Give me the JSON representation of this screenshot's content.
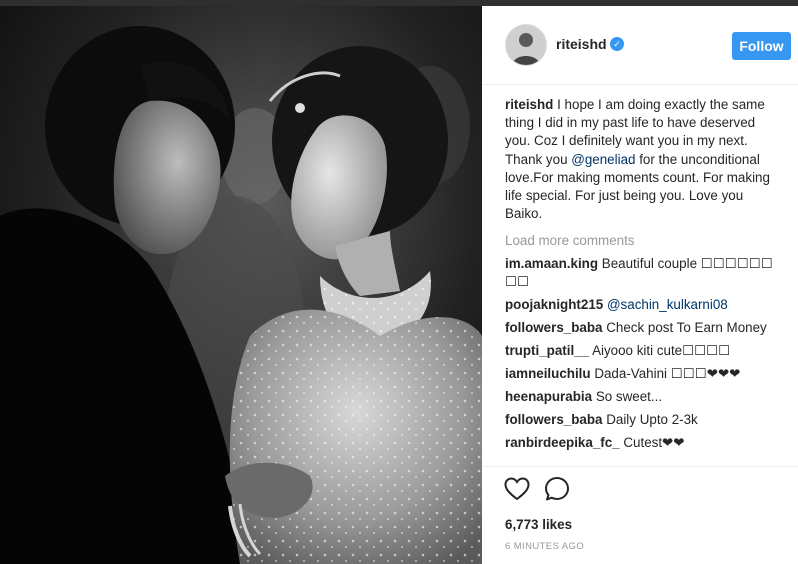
{
  "post": {
    "username": "riteishd",
    "follow_label": "Follow",
    "caption_author": "riteishd",
    "caption_part1": "I hope I am doing exactly the same thing I did in my past life to have deserved you. Coz I definitely want you in my next. Thank you ",
    "caption_mention": "@geneliad",
    "caption_part2": " for the unconditional love.For making moments count. For making life special. For just being you. Love you Baiko.",
    "load_more": "Load more comments",
    "comments": [
      {
        "user": "im.amaan.king",
        "text": "Beautiful couple ☐☐☐☐☐☐ ☐☐"
      },
      {
        "user": "poojaknight215",
        "text": "@sachin_kulkarni08"
      },
      {
        "user": "followers_baba",
        "text": "Check post To Earn Money"
      },
      {
        "user": "trupti_patil__",
        "text": "Aiyooo kiti cute☐☐☐☐"
      },
      {
        "user": "iamneiluchilu",
        "text": "Dada-Vahini ☐☐☐❤❤❤"
      },
      {
        "user": "heenapurabia",
        "text": "So sweet..."
      },
      {
        "user": "followers_baba",
        "text": "Daily Upto 2-3k"
      },
      {
        "user": "ranbirdeepika_fc_",
        "text": "Cutest❤❤"
      }
    ],
    "likes": "6,773 likes",
    "timestamp": "6 MINUTES AGO"
  },
  "colors": {
    "accent": "#3897f0",
    "text": "#262626",
    "muted": "#999999",
    "mention": "#003569"
  },
  "icons": [
    "verified-badge-icon",
    "heart-icon",
    "comment-icon"
  ]
}
